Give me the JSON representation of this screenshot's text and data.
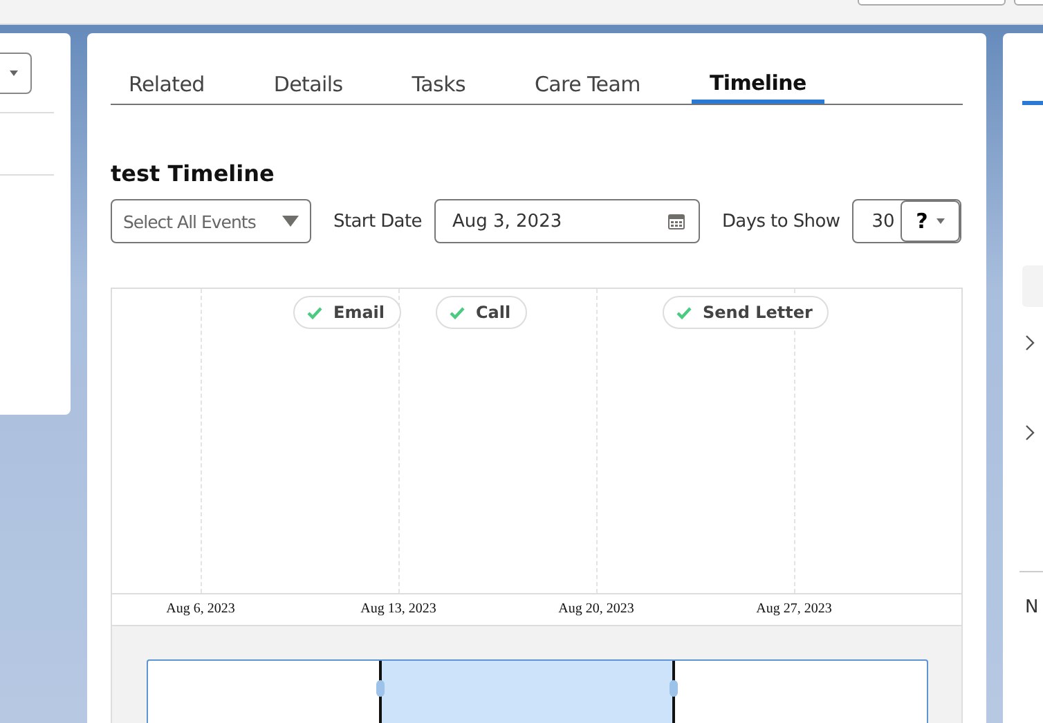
{
  "tabs": [
    {
      "label": "Related",
      "selected": false
    },
    {
      "label": "Details",
      "selected": false
    },
    {
      "label": "Tasks",
      "selected": false
    },
    {
      "label": "Care Team",
      "selected": false
    },
    {
      "label": "Timeline",
      "selected": true
    }
  ],
  "timeline": {
    "title": "test Timeline",
    "event_filter": {
      "value": "Select All Events"
    },
    "start_date": {
      "label": "Start Date",
      "value": "Aug 3, 2023"
    },
    "days_to_show": {
      "label": "Days to Show",
      "value": "30",
      "help": "?"
    },
    "events": [
      {
        "name": "Email",
        "done": true
      },
      {
        "name": "Call",
        "done": true
      },
      {
        "name": "Send Letter",
        "done": true
      }
    ],
    "axis_labels": [
      "Aug 6, 2023",
      "Aug 13, 2023",
      "Aug 20, 2023",
      "Aug 27, 2023"
    ]
  },
  "right_panel": {
    "text": "N"
  }
}
